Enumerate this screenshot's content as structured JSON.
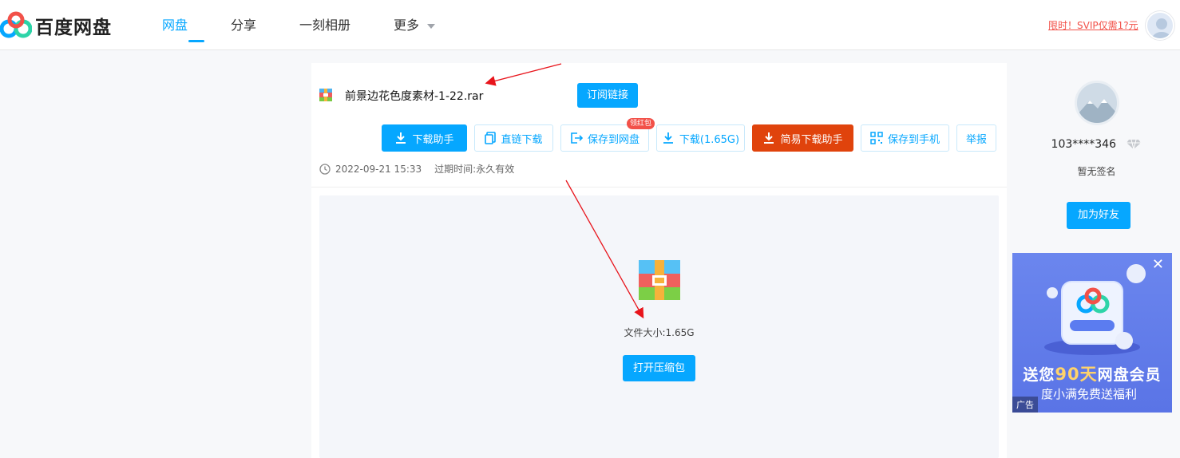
{
  "brand": {
    "logo_text": "百度网盘"
  },
  "nav": {
    "items": [
      "网盘",
      "分享",
      "一刻相册",
      "更多"
    ]
  },
  "header": {
    "promo": "限时！SVIP仅需1?元"
  },
  "file": {
    "name": "前景边花色度素材-1-22.rar",
    "subscribe_label": "订阅链接",
    "date": "2022-09-21 15:33",
    "expire_label": "过期时间:",
    "expire_value": "永久有效",
    "size": "文件大小:1.65G",
    "open_label": "打开压缩包"
  },
  "actions": {
    "download_helper": "下载助手",
    "direct_download": "直链下载",
    "save_to_disk": "保存到网盘",
    "save_badge": "领红包",
    "download": "下载(1.65G)",
    "easy_download": "简易下载助手",
    "save_to_phone": "保存到手机",
    "report": "举报"
  },
  "sidebar": {
    "username": "103****346",
    "signature": "暂无签名",
    "add_friend": "加为好友"
  },
  "ad": {
    "line1_pre": "送您",
    "line1_hl": "90天",
    "line1_post": "网盘会员",
    "line2": "度小满免费送福利",
    "tag": "广告",
    "close": "✕"
  },
  "colors": {
    "accent": "#06a7ff",
    "danger": "#e0430c",
    "promo": "#f25149"
  }
}
